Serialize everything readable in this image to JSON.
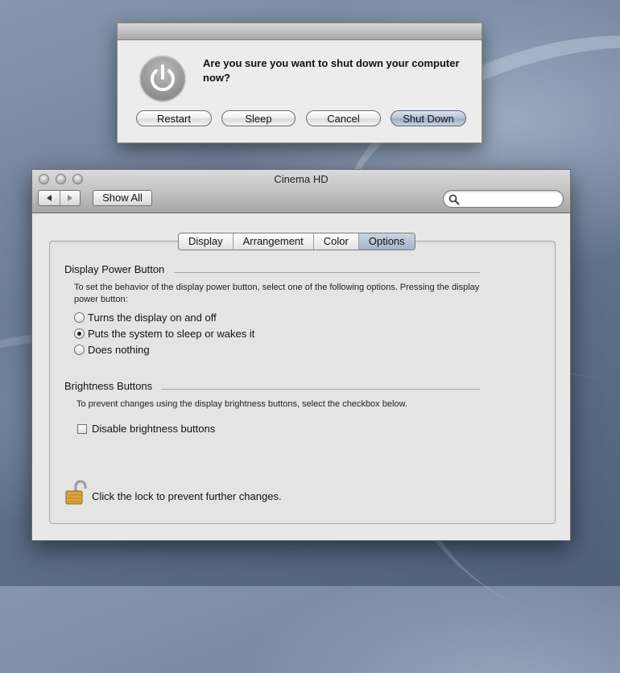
{
  "alert": {
    "message": "Are you sure you want to shut down your computer now?",
    "buttons": {
      "restart": "Restart",
      "sleep": "Sleep",
      "cancel": "Cancel",
      "shutdown": "Shut Down"
    },
    "icon": "power-icon"
  },
  "window": {
    "title": "Cinema HD",
    "show_all": "Show All",
    "search_placeholder": "",
    "tabs": [
      {
        "label": "Display",
        "selected": false
      },
      {
        "label": "Arrangement",
        "selected": false
      },
      {
        "label": "Color",
        "selected": false
      },
      {
        "label": "Options",
        "selected": true
      }
    ]
  },
  "power_section": {
    "title": "Display Power Button",
    "description": "To set the behavior of the display power button, select one of the following options. Pressing the display power button:",
    "options": [
      {
        "label": "Turns the display on and off",
        "selected": false
      },
      {
        "label": "Puts the system to sleep or wakes it",
        "selected": true
      },
      {
        "label": "Does nothing",
        "selected": false
      }
    ]
  },
  "brightness_section": {
    "title": "Brightness Buttons",
    "description": "To prevent changes using the display brightness buttons, select the checkbox below.",
    "checkbox_label": "Disable brightness buttons",
    "checked": false
  },
  "lock": {
    "text": "Click the lock to prevent further changes."
  },
  "colors": {
    "default_button": "#a9b8cd",
    "selected_tab": "#b6c4d8"
  }
}
